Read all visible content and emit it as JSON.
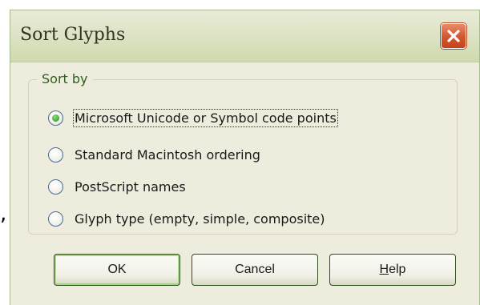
{
  "window": {
    "title": "Sort Glyphs"
  },
  "groupbox": {
    "legend": "Sort by",
    "options": [
      {
        "label": "Microsoft Unicode or Symbol code points",
        "selected": true
      },
      {
        "label": "Standard Macintosh ordering",
        "selected": false
      },
      {
        "label": "PostScript names",
        "selected": false
      },
      {
        "label": "Glyph type (empty, simple, composite)",
        "selected": false
      }
    ]
  },
  "buttons": {
    "ok_label": "OK",
    "cancel_label": "Cancel",
    "help_first": "H",
    "help_rest": "elp"
  },
  "background": {
    "stray_text": ","
  },
  "icons": {
    "close": "close-icon"
  },
  "colors": {
    "dialog_bg": "#eeecdc",
    "titlebar_bg": "#dde3c4",
    "close_button": "#d2562c",
    "legend_text": "#2e5e1e",
    "radio_dot": "#3ea534",
    "default_button_glow": "#a8d384"
  }
}
